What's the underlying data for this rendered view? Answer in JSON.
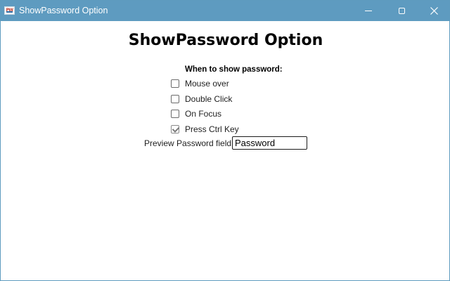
{
  "window": {
    "title": "ShowPassword Option",
    "icon": "app-icon",
    "accent_color": "#5e9bc0",
    "controls": {
      "minimize": "minimize-icon",
      "maximize": "maximize-icon",
      "close": "×"
    }
  },
  "main": {
    "heading": "ShowPassword Option",
    "section_label": "When to show password:",
    "options": [
      {
        "label": "Mouse over",
        "checked": false
      },
      {
        "label": "Double Click",
        "checked": false
      },
      {
        "label": "On Focus",
        "checked": false
      },
      {
        "label": "Press Ctrl Key",
        "checked": true
      }
    ],
    "preview": {
      "label": "Preview Password field:",
      "value": "Password"
    }
  }
}
